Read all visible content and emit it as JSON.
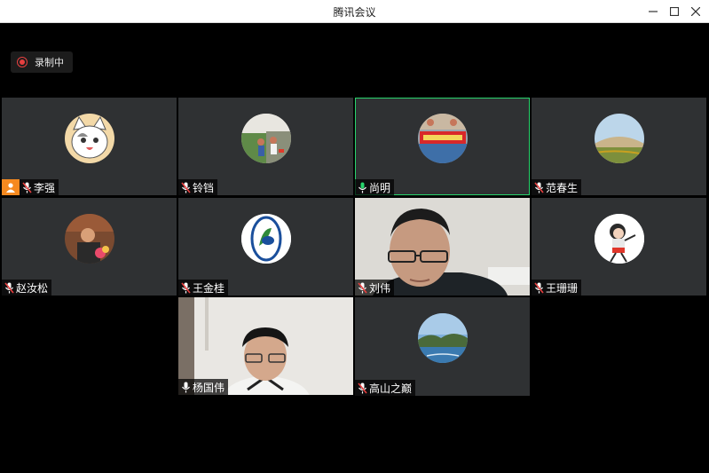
{
  "window": {
    "title": "腾讯会议",
    "min_icon": "minimize-icon",
    "max_icon": "maximize-icon",
    "close_icon": "close-icon"
  },
  "recording": {
    "label": "录制中",
    "color": "#e84040"
  },
  "colors": {
    "active_speaker": "#27d46c",
    "tile_bg": "#2f3133",
    "host_badge": "#f5891f"
  },
  "participants": [
    {
      "name": "李强",
      "mic": "muted",
      "host": true
    },
    {
      "name": "铃铛",
      "mic": "muted"
    },
    {
      "name": "尚明",
      "mic": "on",
      "active": true
    },
    {
      "name": "范春生",
      "mic": "muted"
    },
    {
      "name": "赵汝松",
      "mic": "muted"
    },
    {
      "name": "王金桂",
      "mic": "muted"
    },
    {
      "name": "刘伟",
      "mic": "muted",
      "video": true
    },
    {
      "name": "王珊珊",
      "mic": "muted"
    },
    {
      "name": "杨国伟",
      "mic": "on",
      "video": true
    },
    {
      "name": "高山之巅",
      "mic": "muted"
    }
  ]
}
